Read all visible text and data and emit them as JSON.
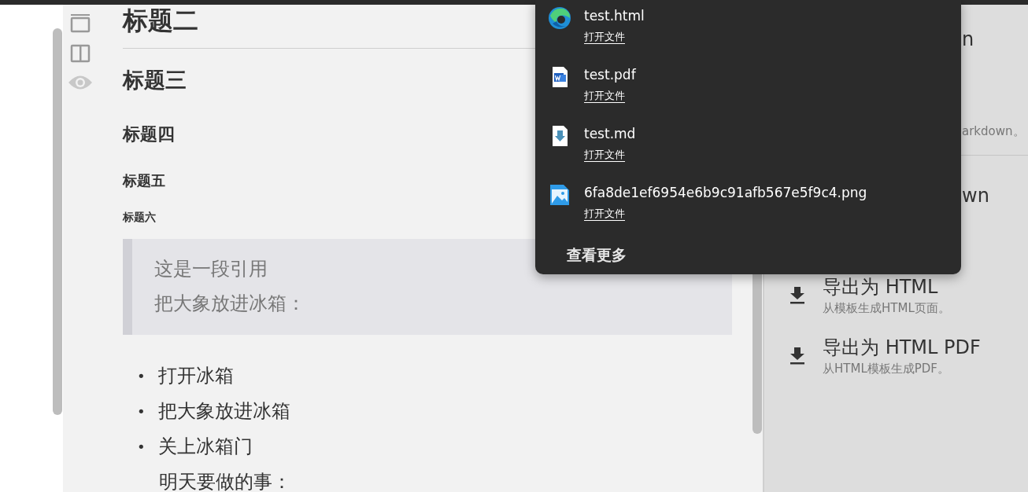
{
  "toolbar": {
    "icons": [
      {
        "kind": "single"
      },
      {
        "kind": "split"
      },
      {
        "kind": "preview"
      }
    ]
  },
  "document": {
    "headings": [
      {
        "kind": "h2",
        "text": "标题二"
      },
      {
        "kind": "h3",
        "text": "标题三"
      },
      {
        "kind": "h4",
        "text": "标题四"
      },
      {
        "kind": "h5",
        "text": "标题五"
      },
      {
        "kind": "h6",
        "text": "标题六"
      }
    ],
    "quote": [
      "这是一段引用",
      "把大象放进冰箱："
    ],
    "list": [
      {
        "marker": "•",
        "text": "打开冰箱"
      },
      {
        "marker": "•",
        "text": "把大象放进冰箱"
      },
      {
        "marker": "•",
        "text": "关上冰箱门"
      }
    ],
    "after_list": "明天要做的事："
  },
  "export_panel": {
    "items": [
      {
        "kind": "covered",
        "title": "n",
        "description": "arkdown。"
      },
      {
        "kind": "covered",
        "title": "wn"
      },
      {
        "kind": "export",
        "title": "导出为 HTML",
        "description": "从模板生成HTML页面。"
      },
      {
        "kind": "export",
        "title": "导出为 HTML PDF",
        "description": "从HTML模板生成PDF。"
      }
    ]
  },
  "downloads_popup": {
    "files": [
      {
        "kind": "browser",
        "name": "test.html",
        "action": "打开文件"
      },
      {
        "kind": "word",
        "name": "test.pdf",
        "action": "打开文件"
      },
      {
        "kind": "download",
        "name": "test.md",
        "action": "打开文件"
      },
      {
        "kind": "image",
        "name": "6fa8de1ef6954e6b9c91afb567e5f9c4.png",
        "action": "打开文件"
      }
    ],
    "more": "查看更多"
  }
}
